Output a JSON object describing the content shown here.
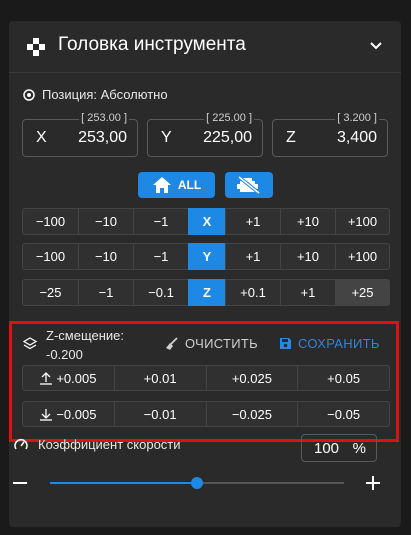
{
  "header": {
    "title": "Головка инструмента",
    "icon": "gamepad-icon"
  },
  "position": {
    "label": "Позиция: Абсолютно",
    "axes": [
      {
        "axis": "X",
        "value": "253,00",
        "target": "[ 253.00 ]"
      },
      {
        "axis": "Y",
        "value": "225,00",
        "target": "[ 225.00 ]"
      },
      {
        "axis": "Z",
        "value": "3,400",
        "target": "[ 3.200 ]"
      }
    ]
  },
  "home_button": {
    "label": "ALL"
  },
  "jog": {
    "x": [
      "−100",
      "−10",
      "−1",
      "X",
      "+1",
      "+10",
      "+100"
    ],
    "y": [
      "−100",
      "−10",
      "−1",
      "Y",
      "+1",
      "+10",
      "+100"
    ],
    "z": [
      "−25",
      "−1",
      "−0.1",
      "Z",
      "+0.1",
      "+1",
      "+25"
    ]
  },
  "zoffset": {
    "label": "Z-смещение:",
    "value": "-0.200",
    "clear_label": "ОЧИСТИТЬ",
    "save_label": "СОХРАНИТЬ",
    "up": [
      "+0.005",
      "+0.01",
      "+0.025",
      "+0.05"
    ],
    "down": [
      "−0.005",
      "−0.01",
      "−0.025",
      "−0.05"
    ]
  },
  "speed": {
    "label": "Коэффициент скорости",
    "value": "100",
    "unit": "%",
    "slider_fraction": 0.5
  },
  "colors": {
    "accent": "#1e88e5",
    "panel": "#2a2a2a",
    "highlight": "#e01010"
  }
}
